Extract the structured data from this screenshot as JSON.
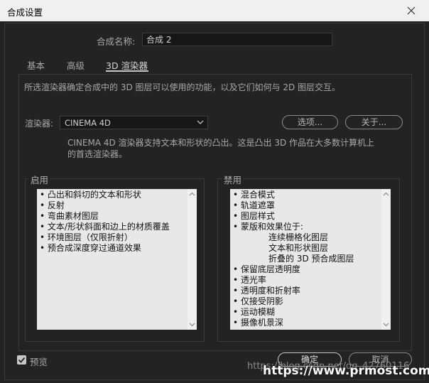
{
  "window": {
    "title": "合成设置"
  },
  "composition": {
    "name_label": "合成名称:",
    "name_value": "合成 2"
  },
  "tabs": [
    {
      "label": "基本",
      "active": false
    },
    {
      "label": "高级",
      "active": false
    },
    {
      "label": "3D 渲染器",
      "active": true
    }
  ],
  "renderer_tab": {
    "description": "所选渲染器确定合成中的 3D 图层可以使用的功能，以及它们如何与 2D 图层交互。",
    "renderer_label": "渲染器:",
    "renderer_value": "CINEMA 4D",
    "options_button": "选项...",
    "about_button": "关于...",
    "renderer_desc_line1": "CINEMA 4D 渲染器支持文本和形状的凸出。这是凸出 3D 作品在大多数计算机上",
    "renderer_desc_line2": "的首选渲染器。",
    "enabled": {
      "title": "启用",
      "items": [
        "• 凸出和斜切的文本和形状",
        "• 反射",
        "• 弯曲素材图层",
        "• 文本/形状斜面和边上的材质覆盖",
        "• 环境图层（仅限折射）",
        "• 预合成深度穿过通道效果"
      ]
    },
    "disabled": {
      "title": "禁用",
      "items": [
        {
          "text": "• 混合模式",
          "indent": false
        },
        {
          "text": "• 轨道遮罩",
          "indent": false
        },
        {
          "text": "• 图层样式",
          "indent": false
        },
        {
          "text": "• 蒙版和效果位于:",
          "indent": false
        },
        {
          "text": "连续栅格化图层",
          "indent": true
        },
        {
          "text": "文本和形状图层",
          "indent": true
        },
        {
          "text": "折叠的 3D 预合成图层",
          "indent": true
        },
        {
          "text": "• 保留底层透明度",
          "indent": false
        },
        {
          "text": "• 透光率",
          "indent": false
        },
        {
          "text": "• 透明度和折射率",
          "indent": false
        },
        {
          "text": "• 仅接受阴影",
          "indent": false
        },
        {
          "text": "• 运动模糊",
          "indent": false
        },
        {
          "text": "• 摄像机景深",
          "indent": false
        }
      ]
    }
  },
  "footer": {
    "preview_label": "预览",
    "preview_checked": true,
    "ok_button": "确定",
    "cancel_button": "取消"
  },
  "watermark": {
    "text": "https://blog.csdn.net/qq_42760116",
    "site": "https://www.prmost.com"
  }
}
